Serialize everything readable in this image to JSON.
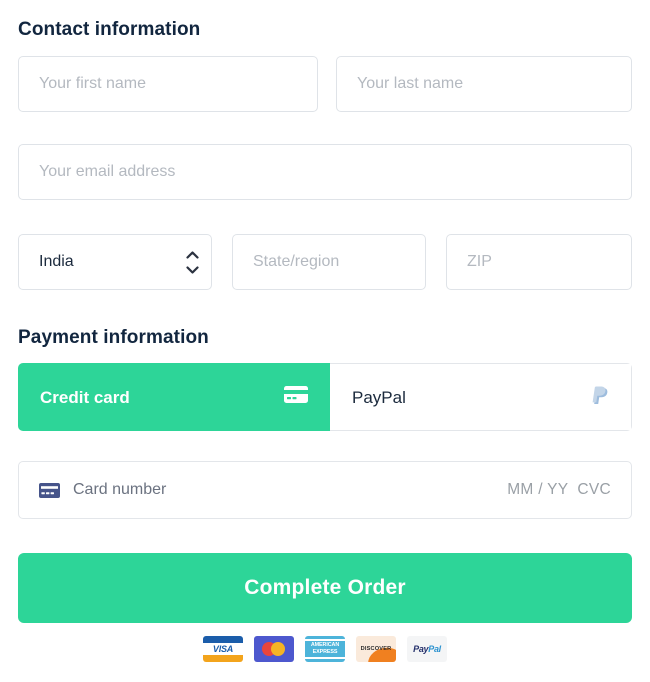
{
  "contact": {
    "title": "Contact information",
    "first_name": {
      "placeholder": "Your first name",
      "value": ""
    },
    "last_name": {
      "placeholder": "Your last name",
      "value": ""
    },
    "email": {
      "placeholder": "Your email address",
      "value": ""
    },
    "country": {
      "value": "India",
      "icon": "stepper-chevrons-icon"
    },
    "state": {
      "placeholder": "State/region",
      "value": ""
    },
    "zip": {
      "placeholder": "ZIP",
      "value": ""
    }
  },
  "payment": {
    "title": "Payment information",
    "tabs": [
      {
        "label": "Credit card",
        "icon": "credit-card-icon",
        "active": true
      },
      {
        "label": "PayPal",
        "icon": "paypal-icon",
        "active": false
      }
    ],
    "card": {
      "icon": "credit-card-icon",
      "number_placeholder": "Card number",
      "expiry_cvc_placeholder": "MM / YY  CVC",
      "value": ""
    }
  },
  "submit": {
    "label": "Complete Order"
  },
  "accepted_logos": [
    {
      "name": "visa",
      "text": "VISA"
    },
    {
      "name": "mastercard",
      "text": ""
    },
    {
      "name": "amex",
      "line1": "AMERICAN",
      "line2": "EXPRESS"
    },
    {
      "name": "discover",
      "text": "DISCOVER"
    },
    {
      "name": "paypal",
      "text_a": "Pay",
      "text_b": "Pal"
    }
  ],
  "colors": {
    "accent_green": "#2dd598",
    "heading_navy": "#12263f",
    "placeholder_gray": "#b4b9c0",
    "border_gray": "#dfe3e8",
    "card_icon_navy": "#46548a"
  }
}
